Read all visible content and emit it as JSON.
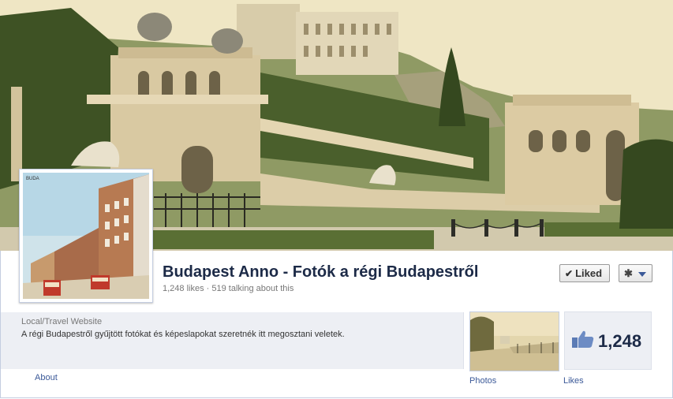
{
  "page": {
    "name": "Budapest Anno - Fotók a régi Budapestről",
    "likes_count": "1,248 likes",
    "talking_about": "519 talking about this",
    "stats_separator": "·"
  },
  "actions": {
    "liked_label": "Liked",
    "liked_icon": "check-icon",
    "settings_icon": "gear-icon"
  },
  "info": {
    "category": "Local/Travel Website",
    "description": "A régi Budapestről gyűjtött fotókat és képeslapokat szeretnék itt megosztani veletek.",
    "about_label": "About"
  },
  "apps": {
    "photos_label": "Photos",
    "likes_label": "Likes",
    "likes_number": "1,248",
    "likes_icon": "thumbs-up-icon"
  },
  "colors": {
    "link": "#3b5998",
    "title": "#1c2a47",
    "panel": "#edeff4"
  }
}
